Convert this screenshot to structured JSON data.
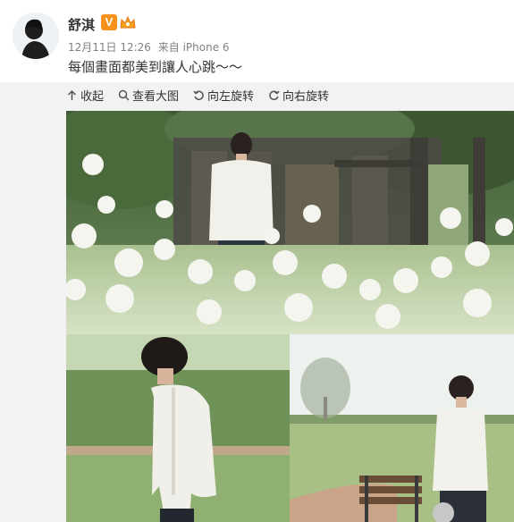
{
  "post": {
    "author": {
      "name": "舒淇",
      "verified_badge": "V",
      "avatar_icon": "avatar-silhouette"
    },
    "meta": {
      "time": "12月11日 12:26",
      "source": "来自 iPhone 6"
    },
    "text": "每個畫面都美到讓人心跳～～"
  },
  "toolbar": {
    "collapse_label": "收起",
    "view_large_label": "查看大图",
    "rotate_left_label": "向左旋转",
    "rotate_right_label": "向右旋转"
  },
  "colors": {
    "badge_orange": "#f7911c",
    "media_background": "#f2f2f5",
    "meta_gray": "#808080"
  }
}
